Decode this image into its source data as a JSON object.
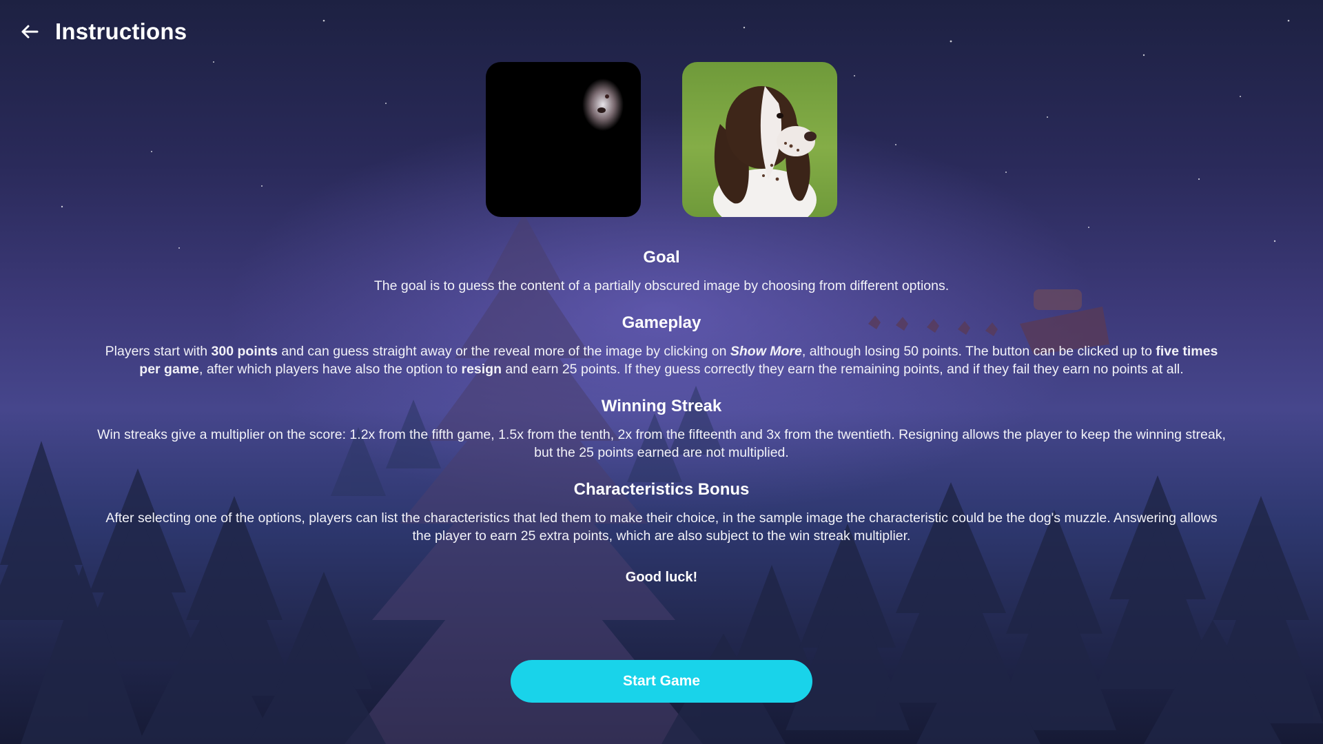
{
  "header": {
    "back_icon": "arrow-left-icon",
    "title": "Instructions"
  },
  "images": {
    "obscured_alt": "Partially obscured sample image",
    "revealed_alt": "Sample image of a dog"
  },
  "sections": {
    "goal": {
      "title": "Goal",
      "text": "The goal is to guess the content of a partially obscured image by choosing from different options."
    },
    "gameplay": {
      "title": "Gameplay",
      "p1": "Players start with ",
      "b1": "300 points",
      "p2": " and can guess straight away or the reveal more of the image by clicking on ",
      "b2": "Show More",
      "p3": ", although losing 50 points. The button can be clicked up to ",
      "b3": "five times per game",
      "p4": ", after which players have also the option to ",
      "b4": "resign",
      "p5": " and earn 25 points. If they guess correctly they earn the remaining points, and if they fail they earn no points at all."
    },
    "winning_streak": {
      "title": "Winning Streak",
      "text": "Win streaks give a multiplier on the score: 1.2x from the fifth game, 1.5x from the tenth, 2x from the fifteenth and 3x from the twentieth. Resigning allows the player to keep the winning streak, but the 25 points earned are not multiplied."
    },
    "characteristics_bonus": {
      "title": "Characteristics Bonus",
      "text": "After selecting one of the options, players can list the characteristics that led them to make their choice, in the sample image the characteristic could be the dog's muzzle. Answering allows the player to earn 25 extra points, which are also subject to the win streak multiplier."
    }
  },
  "good_luck": "Good luck!",
  "start_button": "Start Game",
  "colors": {
    "accent": "#19d3ea",
    "text": "#ffffff"
  }
}
